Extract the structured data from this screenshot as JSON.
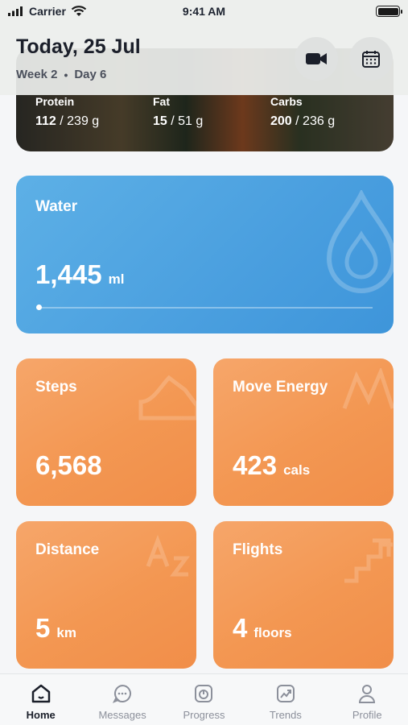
{
  "status_bar": {
    "carrier": "Carrier",
    "time": "9:41 AM"
  },
  "header": {
    "title": "Today, 25 Jul",
    "week": "Week 2",
    "separator": "•",
    "day": "Day 6",
    "video_icon": "video-camera-icon",
    "calendar_icon": "calendar-icon"
  },
  "macros": [
    {
      "label": "Protein",
      "value": "112",
      "target": "/ 239 g"
    },
    {
      "label": "Fat",
      "value": "15",
      "target": "/ 51 g"
    },
    {
      "label": "Carbs",
      "value": "200",
      "target": "/ 236 g"
    }
  ],
  "water": {
    "label": "Water",
    "value": "1,445",
    "unit": "ml",
    "progress": 0.0,
    "icon": "water-drop-icon",
    "color": "#4aa2e0"
  },
  "stats": {
    "steps": {
      "label": "Steps",
      "value": "6,568",
      "unit": "",
      "icon": "shoe-icon"
    },
    "move_energy": {
      "label": "Move Energy",
      "value": "423",
      "unit": "cals",
      "icon": "energy-icon"
    },
    "distance": {
      "label": "Distance",
      "value": "5",
      "unit": "km",
      "icon": "a-to-b-icon"
    },
    "flights": {
      "label": "Flights",
      "value": "4",
      "unit": "floors",
      "icon": "stairs-icon"
    }
  },
  "accent_orange": "#f39752",
  "tabs": [
    {
      "label": "Home",
      "icon": "home-icon",
      "active": true
    },
    {
      "label": "Messages",
      "icon": "chat-bubble-icon",
      "active": false
    },
    {
      "label": "Progress",
      "icon": "scale-icon",
      "active": false
    },
    {
      "label": "Trends",
      "icon": "trend-chart-icon",
      "active": false
    },
    {
      "label": "Profile",
      "icon": "person-icon",
      "active": false
    }
  ]
}
